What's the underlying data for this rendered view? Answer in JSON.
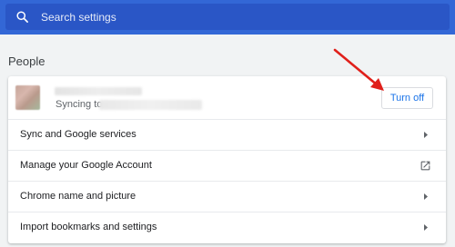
{
  "search": {
    "placeholder": "Search settings"
  },
  "section": {
    "title": "People"
  },
  "account": {
    "sync_label": "Syncing to",
    "turn_off_label": "Turn off"
  },
  "rows": [
    {
      "label": "Sync and Google services",
      "icon": "chevron-right-icon"
    },
    {
      "label": "Manage your Google Account",
      "icon": "open-in-new-icon"
    },
    {
      "label": "Chrome name and picture",
      "icon": "chevron-right-icon"
    },
    {
      "label": "Import bookmarks and settings",
      "icon": "chevron-right-icon"
    }
  ],
  "colors": {
    "header": "#3367d6",
    "searchbox": "#2a56c6",
    "accent": "#1a73e8",
    "annotation_arrow": "#e0201b",
    "background": "#f1f3f4"
  }
}
